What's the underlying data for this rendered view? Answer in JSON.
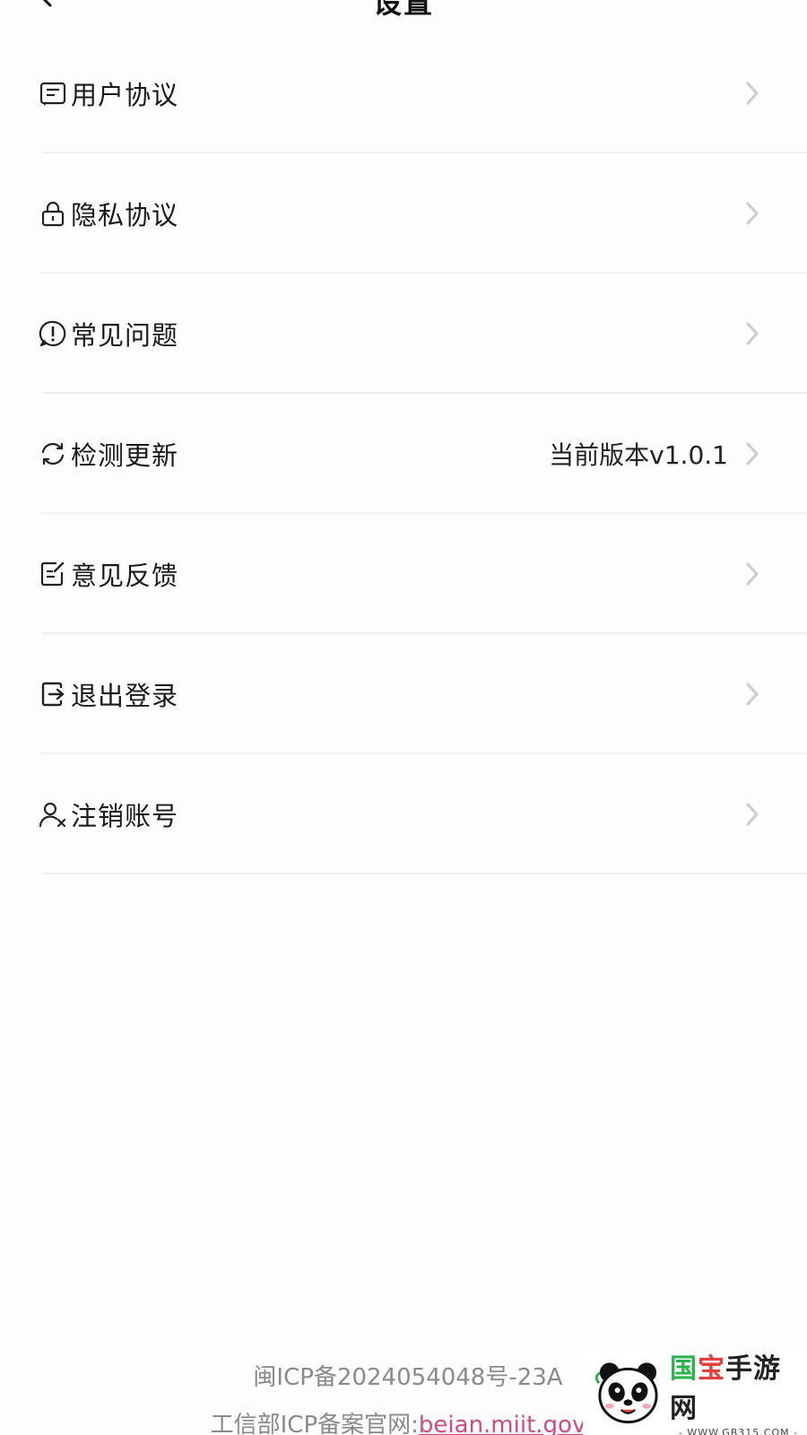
{
  "header": {
    "title": "设置",
    "back_icon": "back-arrow-icon"
  },
  "menu": {
    "items": [
      {
        "label": "用户协议",
        "icon": "document-icon"
      },
      {
        "label": "隐私协议",
        "icon": "lock-icon"
      },
      {
        "label": "常见问题",
        "icon": "question-icon"
      },
      {
        "label": "检测更新",
        "icon": "refresh-icon",
        "value": "当前版本v1.0.1"
      },
      {
        "label": "意见反馈",
        "icon": "edit-note-icon"
      },
      {
        "label": "退出登录",
        "icon": "logout-icon"
      },
      {
        "label": "注销账号",
        "icon": "user-remove-icon"
      }
    ]
  },
  "footer": {
    "icp_number": "闽ICP备2024054048号-23A",
    "icp_site_label": "工信部ICP备案官网:",
    "icp_site_link": "beian.miit.gov"
  },
  "watermark": {
    "brand": [
      "国",
      "宝",
      "手游网"
    ],
    "url": "- WWW.GB315.COM -"
  },
  "colors": {
    "accent_link": "#d14a83",
    "watermark_green": "#2bb24c",
    "watermark_red": "#e2403c"
  }
}
